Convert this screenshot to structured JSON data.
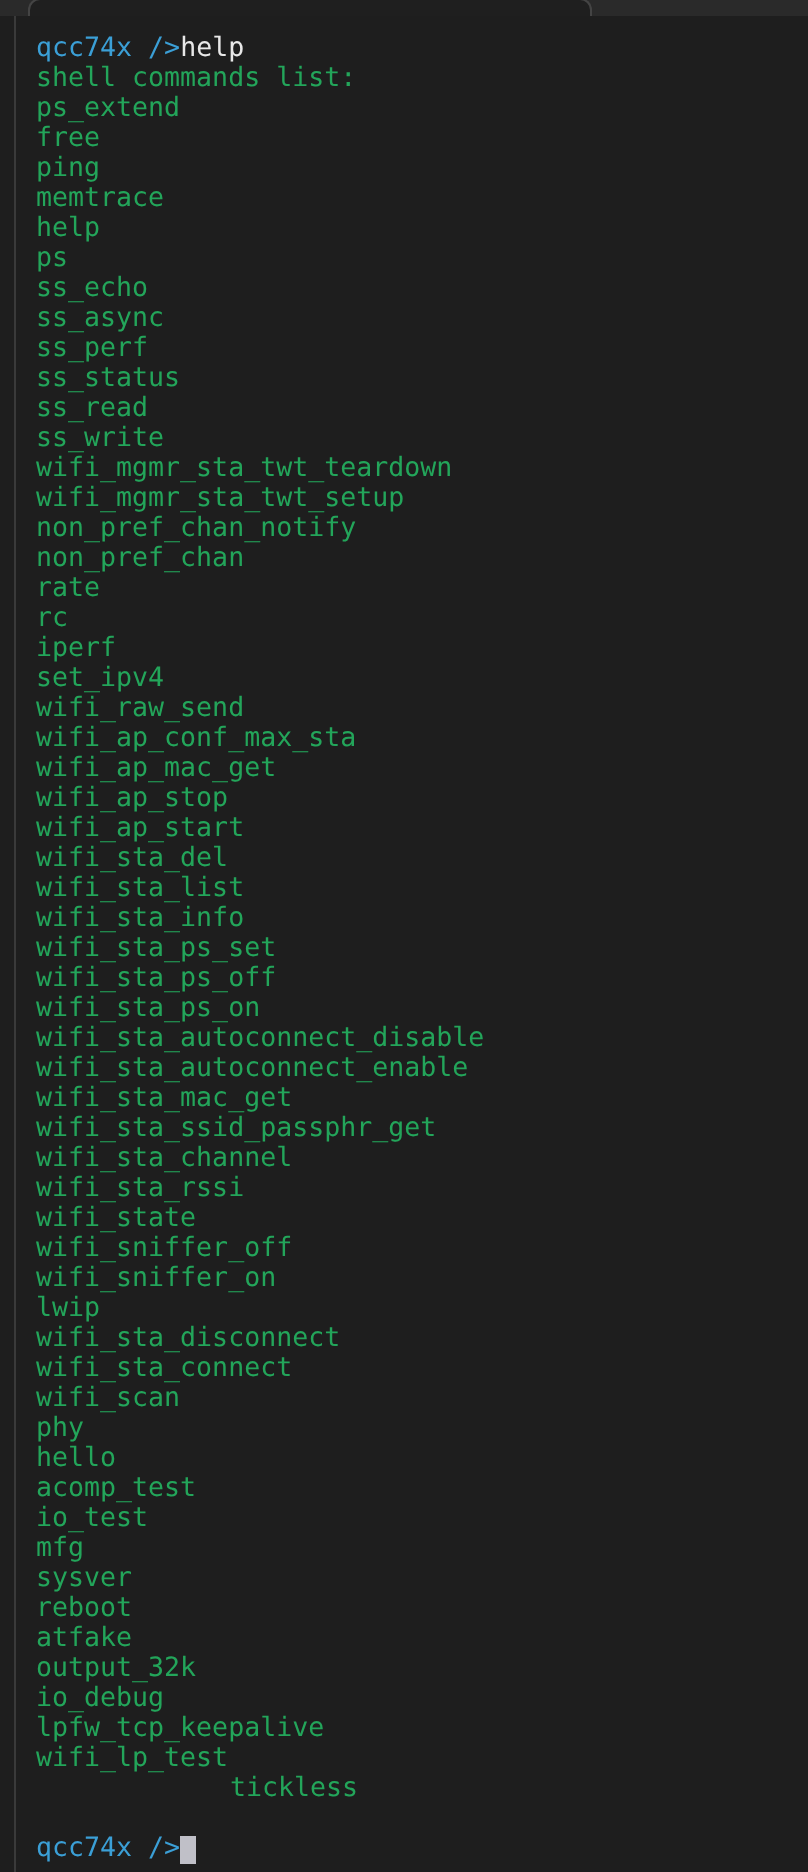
{
  "terminal": {
    "command": {
      "prompt": "qcc74x />",
      "input": "help"
    },
    "output": [
      "shell commands list:",
      "ps_extend",
      "free",
      "ping",
      "memtrace",
      "help",
      "ps",
      "ss_echo",
      "ss_async",
      "ss_perf",
      "ss_status",
      "ss_read",
      "ss_write",
      "wifi_mgmr_sta_twt_teardown",
      "wifi_mgmr_sta_twt_setup",
      "non_pref_chan_notify",
      "non_pref_chan",
      "rate",
      "rc",
      "iperf",
      "set_ipv4",
      "wifi_raw_send",
      "wifi_ap_conf_max_sta",
      "wifi_ap_mac_get",
      "wifi_ap_stop",
      "wifi_ap_start",
      "wifi_sta_del",
      "wifi_sta_list",
      "wifi_sta_info",
      "wifi_sta_ps_set",
      "wifi_sta_ps_off",
      "wifi_sta_ps_on",
      "wifi_sta_autoconnect_disable",
      "wifi_sta_autoconnect_enable",
      "wifi_sta_mac_get",
      "wifi_sta_ssid_passphr_get",
      "wifi_sta_channel",
      "wifi_sta_rssi",
      "wifi_state",
      "wifi_sniffer_off",
      "wifi_sniffer_on",
      "lwip",
      "wifi_sta_disconnect",
      "wifi_sta_connect",
      "wifi_scan",
      "phy",
      "hello",
      "acomp_test",
      "io_test",
      "mfg",
      "sysver",
      "reboot",
      "atfake",
      "output_32k",
      "io_debug",
      "lpfw_tcp_keepalive",
      "wifi_lp_test"
    ],
    "continuation": "tickless",
    "current_prompt": {
      "prompt": "qcc74x />",
      "cursor": true
    }
  }
}
